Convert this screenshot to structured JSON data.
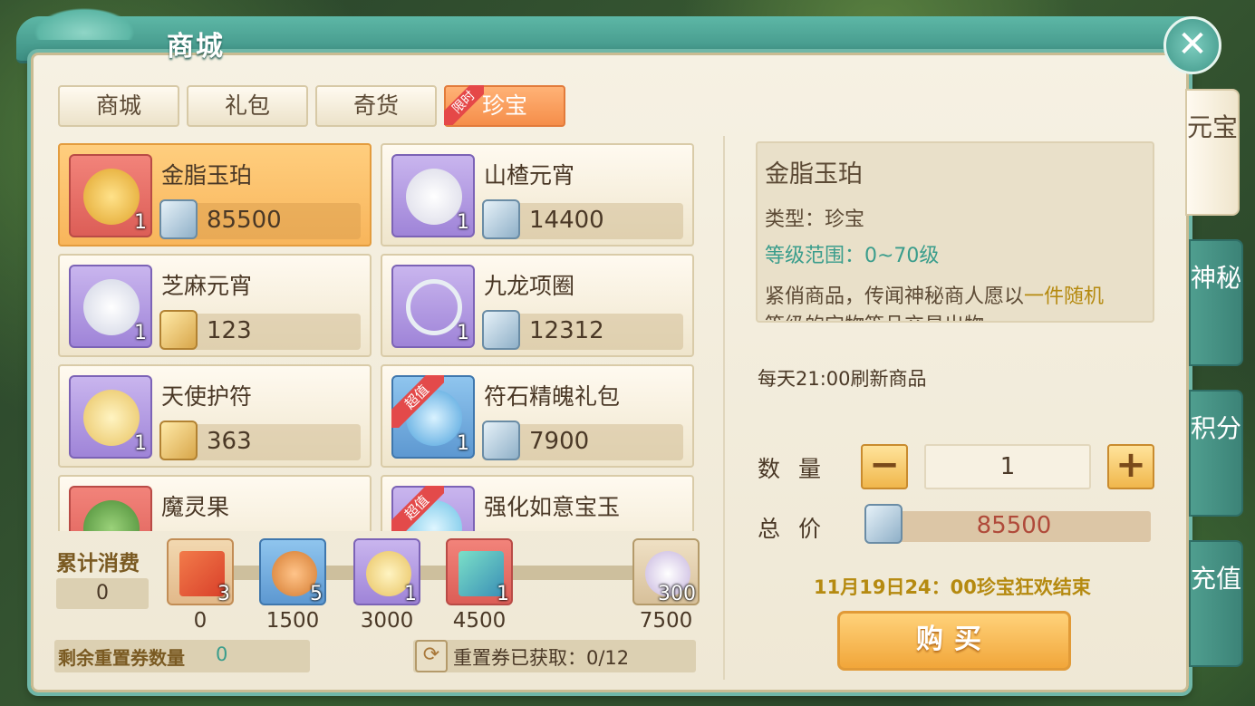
{
  "title": "商城",
  "tabs": [
    {
      "label": "商城"
    },
    {
      "label": "礼包"
    },
    {
      "label": "奇货"
    },
    {
      "label": "珍宝",
      "tag": "限时",
      "active": true
    }
  ],
  "items": [
    {
      "name": "金脂玉珀",
      "qty": "1",
      "price": "85500",
      "currency": "silver",
      "frame": "red",
      "selected": true
    },
    {
      "name": "山楂元宵",
      "qty": "1",
      "price": "14400",
      "currency": "silver",
      "frame": "purple"
    },
    {
      "name": "芝麻元宵",
      "qty": "1",
      "price": "123",
      "currency": "gold",
      "frame": "purple"
    },
    {
      "name": "九龙项圈",
      "qty": "1",
      "price": "12312",
      "currency": "silver",
      "frame": "purple"
    },
    {
      "name": "天使护符",
      "qty": "1",
      "price": "363",
      "currency": "gold",
      "frame": "purple"
    },
    {
      "name": "符石精魄礼包",
      "qty": "1",
      "price": "7900",
      "currency": "silver",
      "frame": "blue",
      "badge": "超值"
    },
    {
      "name": "魔灵果",
      "qty": "",
      "price": "",
      "currency": "gold",
      "frame": "red"
    },
    {
      "name": "强化如意宝玉",
      "qty": "",
      "price": "",
      "currency": "silver",
      "frame": "purple",
      "badge": "超值"
    }
  ],
  "accumulate": {
    "label": "累计消费",
    "value": "0",
    "rewards": [
      {
        "qty": "3",
        "milestone": "0",
        "icon": "ticket-icon",
        "frame": "red"
      },
      {
        "qty": "5",
        "milestone": "1500",
        "icon": "bag-icon",
        "frame": "blue"
      },
      {
        "qty": "1",
        "milestone": "3000",
        "icon": "amulet-icon",
        "frame": "purple"
      },
      {
        "qty": "1",
        "milestone": "4500",
        "icon": "crystal-icon",
        "frame": "red"
      },
      {
        "qty": "300",
        "milestone": "7500",
        "icon": "vase-icon",
        "frame": "tan"
      }
    ]
  },
  "reset": {
    "remaining_label": "剩余重置券数量",
    "remaining_value": "0",
    "obtained_label": "重置券已获取：0/12"
  },
  "detail": {
    "name": "金脂玉珀",
    "type": "类型：珍宝",
    "level": "等级范围：0~70级",
    "desc_main": "紧俏商品，传闻神秘商人愿以",
    "desc_highlight": "一件随机",
    "desc_tail": "等级的宝物等品交易出物"
  },
  "refresh_text": "每天21:00刷新商品",
  "quantity_label": "数量",
  "quantity_value": "1",
  "total_label": "总价",
  "total_value": "85500",
  "event_end": "11月19日24：00珍宝狂欢结束",
  "buy_label": "购买",
  "side_tabs": [
    {
      "label": "元宝",
      "active": true
    },
    {
      "label": "神秘"
    },
    {
      "label": "积分"
    },
    {
      "label": "充值"
    }
  ],
  "colors": {
    "accent_teal": "#3d8f83",
    "active_tab": "#f58e4a",
    "highlight_gold": "#b58a10"
  }
}
